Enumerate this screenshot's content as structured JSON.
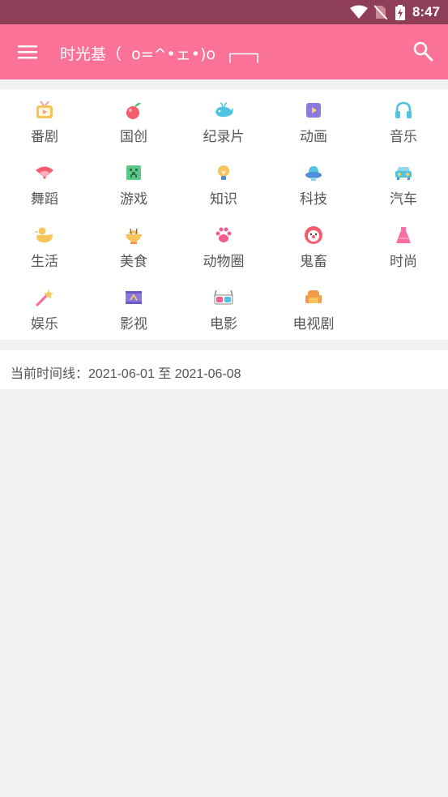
{
  "status_bar": {
    "time": "8:47"
  },
  "app_bar": {
    "title": "时光基（  o=^•ェ•)o  ┌──┐"
  },
  "categories": [
    {
      "label": "番剧",
      "icon": "tv-icon"
    },
    {
      "label": "国创",
      "icon": "fruit-icon"
    },
    {
      "label": "纪录片",
      "icon": "whale-icon"
    },
    {
      "label": "动画",
      "icon": "play-icon"
    },
    {
      "label": "音乐",
      "icon": "headphones-icon"
    },
    {
      "label": "舞蹈",
      "icon": "fan-icon"
    },
    {
      "label": "游戏",
      "icon": "creeper-icon"
    },
    {
      "label": "知识",
      "icon": "lightbulb-icon"
    },
    {
      "label": "科技",
      "icon": "ufo-icon"
    },
    {
      "label": "汽车",
      "icon": "car-icon"
    },
    {
      "label": "生活",
      "icon": "duck-icon"
    },
    {
      "label": "美食",
      "icon": "food-icon"
    },
    {
      "label": "动物圈",
      "icon": "paw-icon"
    },
    {
      "label": "鬼畜",
      "icon": "clown-icon"
    },
    {
      "label": "时尚",
      "icon": "dress-icon"
    },
    {
      "label": "娱乐",
      "icon": "magic-wand-icon"
    },
    {
      "label": "影视",
      "icon": "film-icon"
    },
    {
      "label": "电影",
      "icon": "3d-glasses-icon"
    },
    {
      "label": "电视剧",
      "icon": "sofa-icon"
    }
  ],
  "timeline": {
    "text": "当前时间线：2021-06-01 至 2021-06-08"
  }
}
